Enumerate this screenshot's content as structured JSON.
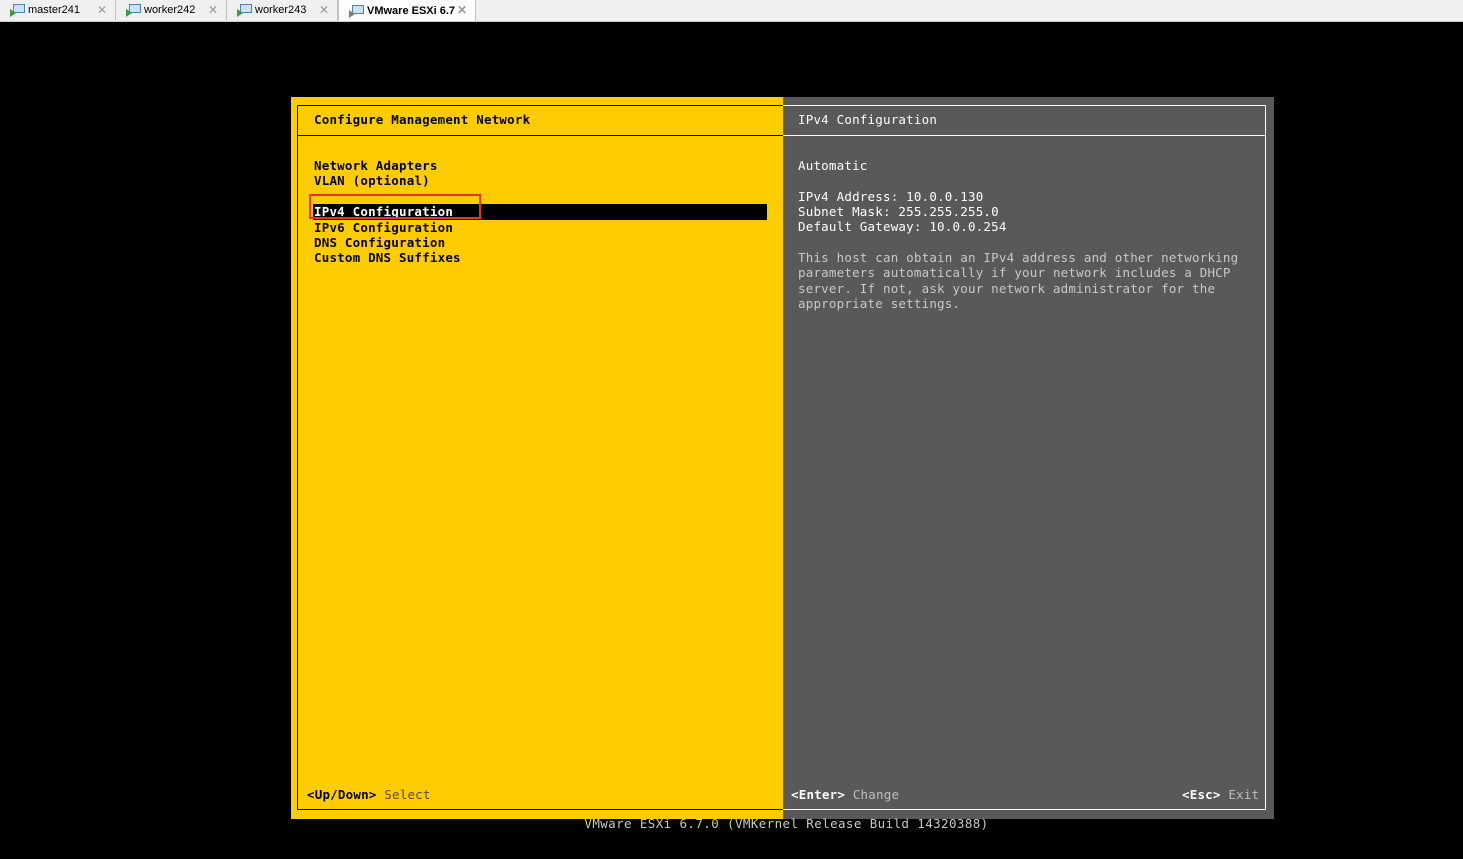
{
  "tabs": [
    {
      "label": "master241",
      "active": false
    },
    {
      "label": "worker242",
      "active": false
    },
    {
      "label": "worker243",
      "active": false
    },
    {
      "label": "VMware ESXi 6.7",
      "active": true
    }
  ],
  "close_glyph": "✕",
  "dcui": {
    "left_title": "Configure Management Network",
    "menu": [
      "Network Adapters",
      "VLAN (optional)",
      "IPv4 Configuration",
      "IPv6 Configuration",
      "DNS Configuration",
      "Custom DNS Suffixes"
    ],
    "selected_index": 2,
    "right_title": "IPv4 Configuration",
    "mode": "Automatic",
    "ipv4_address": "IPv4 Address: 10.0.0.130",
    "subnet_mask": "Subnet Mask: 255.255.255.0",
    "default_gateway": "Default Gateway: 10.0.0.254",
    "description": [
      "This host can obtain an IPv4 address and other networking",
      "parameters automatically if your network includes a DHCP",
      "server. If not, ask your network administrator for the",
      "appropriate settings."
    ],
    "footer_left_key": "<Up/Down>",
    "footer_left_action": "Select",
    "footer_mid_key": "<Enter>",
    "footer_mid_action": "Change",
    "footer_right_key": "<Esc>",
    "footer_right_action": "Exit"
  },
  "build_text": "VMware ESXi 6.7.0 (VMKernel Release Build 14320388)",
  "colors": {
    "left_pane": "#ffcc00",
    "right_pane": "#595959",
    "highlight_box": "#e8322a"
  }
}
